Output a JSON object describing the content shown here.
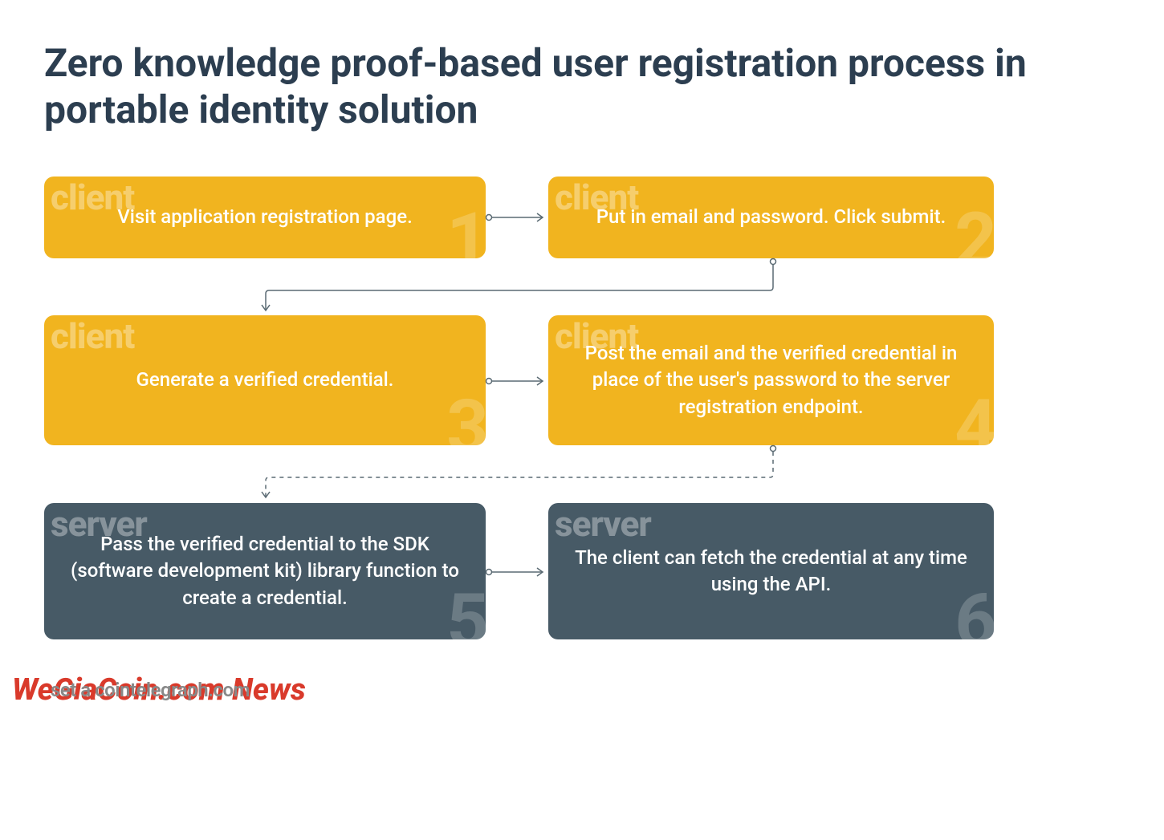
{
  "title": "Zero knowledge proof-based user registration process in portable identity solution",
  "steps": [
    {
      "role": "client",
      "num": "1",
      "text": "Visit application registration page."
    },
    {
      "role": "client",
      "num": "2",
      "text": "Put in email and password. Click submit."
    },
    {
      "role": "client",
      "num": "3",
      "text": "Generate a verified credential."
    },
    {
      "role": "client",
      "num": "4",
      "text": "Post the email and the verified credential in place of the user's password to the server registration endpoint."
    },
    {
      "role": "server",
      "num": "5",
      "text": "Pass the verified credential to the SDK (software development kit) library function to create a credential."
    },
    {
      "role": "server",
      "num": "6",
      "text": "The client can fetch the credential at any time using the API."
    }
  ],
  "watermark_front": "WeGiaCoin.com News",
  "watermark_back": "set a cointelegraph.com",
  "colors": {
    "client": "#f1b41f",
    "server": "#475a66",
    "line": "#5a6a73"
  }
}
